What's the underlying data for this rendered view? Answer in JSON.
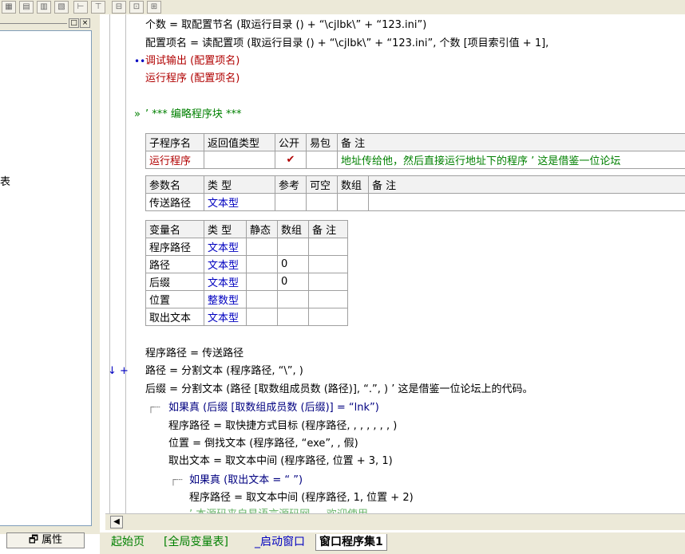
{
  "toolbar": {
    "buttons": [
      "grid-icon",
      "table-icon",
      "chart-icon",
      "split-icon",
      "h-icon",
      "t-icon",
      "minus-icon",
      "box-icon",
      "plus-icon"
    ]
  },
  "left": {
    "fragment": "表",
    "props_label": "属性"
  },
  "code": {
    "line1": "个数 = 取配置节名 (取运行目录 () + “\\cjlbk\\” + “123.ini”)",
    "line2": "配置项名 = 读配置项 (取运行目录 () + “\\cjlbk\\” + “123.ini”, 个数 [项目索引值 + 1],",
    "line3": "调试输出 (配置项名)",
    "line4": "运行程序 (配置项名)",
    "line5": "’ *** 编略程序块 ***",
    "sub_header": [
      "子程序名",
      "返回值类型",
      "公开",
      "易包",
      "备 注"
    ],
    "sub_row": [
      "运行程序",
      "",
      "✔",
      "",
      "地址传给他，然后直接运行地址下的程序 ’ 这是借鉴一位论坛"
    ],
    "param_header": [
      "参数名",
      "类 型",
      "参考",
      "可空",
      "数组",
      "备 注"
    ],
    "param_row": [
      "传送路径",
      "文本型",
      "",
      "",
      "",
      ""
    ],
    "var_header": [
      "变量名",
      "类 型",
      "静态",
      "数组",
      "备 注"
    ],
    "var_rows": [
      [
        "程序路径",
        "文本型",
        "",
        "",
        ""
      ],
      [
        "路径",
        "文本型",
        "",
        "0",
        ""
      ],
      [
        "后缀",
        "文本型",
        "",
        "0",
        ""
      ],
      [
        "位置",
        "整数型",
        "",
        "",
        ""
      ],
      [
        "取出文本",
        "文本型",
        "",
        "",
        ""
      ]
    ],
    "body1": "程序路径 = 传送路径",
    "body2": "路径 = 分割文本 (程序路径, “\\”, )",
    "body3": "后缀 = 分割文本 (路径 [取数组成员数 (路径)], “.”, ) ’ 这是借鉴一位论坛上的代码。",
    "body4": "如果真 (后缀 [取数组成员数 (后缀)] = “lnk”)",
    "body5": "程序路径 = 取快捷方式目标 (程序路径, , , , , , , )",
    "body6": "位置 = 倒找文本 (程序路径, “exe”, , 假)",
    "body7": "取出文本 = 取文本中间 (程序路径, 位置 + 3, 1)",
    "body8": "如果真 (取出文本 = “ ”)",
    "body9": "程序路径 = 取文本中间 (程序路径, 1, 位置 + 2)",
    "body10": "’ 本源码来自易语言源码网 ... 欢迎使用"
  },
  "tabs": [
    "起始页",
    "[全局变量表]",
    "_启动窗口",
    "窗口程序集1"
  ],
  "colors": {
    "keyword": "#b00000",
    "comment": "#008000",
    "type": "#0000c0"
  }
}
